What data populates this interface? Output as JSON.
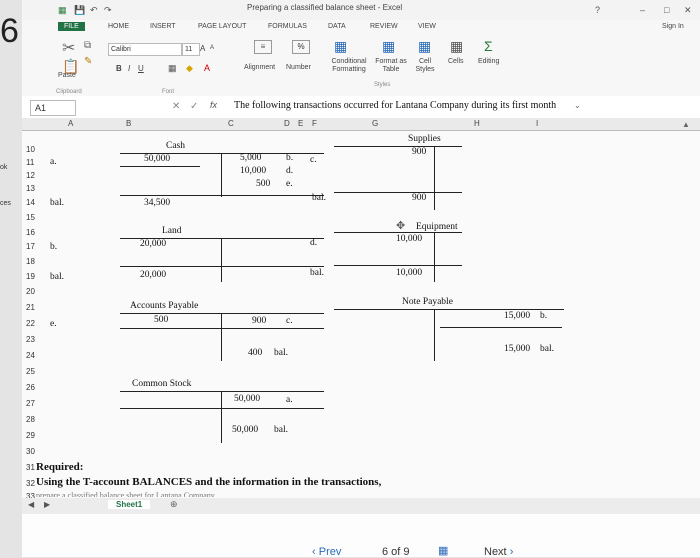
{
  "left_gutter": {
    "big_digit": "6",
    "labels": [
      "ok",
      "ces"
    ]
  },
  "window": {
    "title": "Preparing a classified balance sheet - Excel",
    "signin": "Sign In"
  },
  "tabs": [
    "FILE",
    "HOME",
    "INSERT",
    "PAGE LAYOUT",
    "FORMULAS",
    "DATA",
    "REVIEW",
    "VIEW"
  ],
  "ribbon": {
    "paste": "Paste",
    "font_name": "Calibri",
    "font_size": "11",
    "grow_font": "A",
    "shrink_font": "A",
    "bold": "B",
    "italic": "I",
    "underline": "U",
    "percent": "%",
    "alignment": "Alignment",
    "number": "Number",
    "conditional": "Conditional Formatting",
    "format_table": "Format as Table",
    "cell_styles": "Cell Styles",
    "cells": "Cells",
    "editing": "Editing",
    "groups": {
      "clipboard": "Clipboard",
      "font": "Font",
      "styles": "Styles"
    }
  },
  "formula_bar": {
    "cell_ref": "A1",
    "fx": "fx",
    "content": "The following transactions occurred for Lantana Company during its first month"
  },
  "columns": [
    "A",
    "B",
    "C",
    "D",
    "E",
    "F",
    "G",
    "H",
    "I"
  ],
  "rows": [
    "10",
    "11",
    "12",
    "13",
    "14",
    "15",
    "16",
    "17",
    "18",
    "19",
    "20",
    "21",
    "22",
    "23",
    "24",
    "25",
    "26",
    "27",
    "28",
    "29",
    "30",
    "31",
    "32",
    "33"
  ],
  "cells": {
    "r11a": "a.",
    "r14a": "bal.",
    "r17a": "b.",
    "r19a": "bal.",
    "r22a": "e.",
    "cash_title": "Cash",
    "cash_11": "50,000",
    "cash_11c": "5,000",
    "cash_11d": "b.",
    "cash_11e": "c.",
    "cash_12c": "10,000",
    "cash_12d": "d.",
    "cash_13c": "500",
    "cash_13d": "e.",
    "cash_bal": "34,500",
    "land_title": "Land",
    "land_17": "20,000",
    "land_19": "20,000",
    "ap_title": "Accounts Payable",
    "ap_22": "500",
    "ap_22c": "900",
    "ap_22d": "c.",
    "ap_24c": "400",
    "ap_24d": "bal.",
    "cs_title": "Common Stock",
    "cs_27c": "50,000",
    "cs_27d": "a.",
    "cs_29c": "50,000",
    "cs_29d": "bal.",
    "supplies_title": "Supplies",
    "supplies_val": "900",
    "f14": "bal.",
    "supplies_bal": "900",
    "equip_title": "Equipment",
    "equip_val": "10,000",
    "f17": "d.",
    "f19": "bal.",
    "equip_bal": "10,000",
    "np_title": "Note Payable",
    "np_val": "15,000",
    "np_lbl": "b.",
    "np_bal": "15,000",
    "np_bal_lbl": "bal.",
    "required": "Required:",
    "instruction": "Using the T-account BALANCES and the information in the transactions,",
    "row33": "prepare a classified balance sheet for Lantana Company"
  },
  "sheet_tab": "Sheet1",
  "bottom_nav": {
    "prev": "Prev",
    "page": "6 of 9",
    "next": "Next"
  }
}
